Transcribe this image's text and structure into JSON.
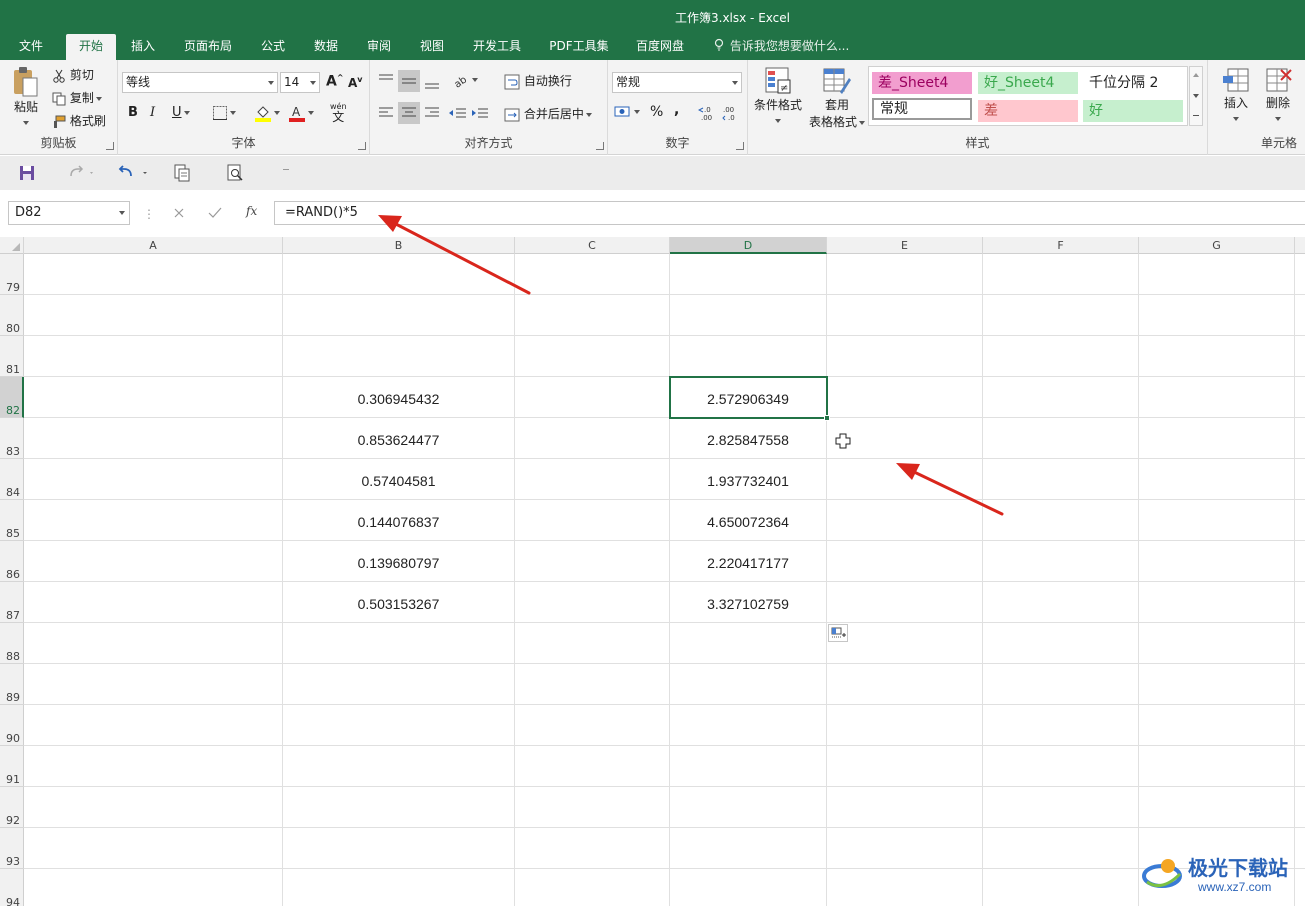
{
  "window": {
    "title": "工作簿3.xlsx - Excel"
  },
  "tabs": [
    {
      "label": "文件",
      "active": false
    },
    {
      "label": "开始",
      "active": true
    },
    {
      "label": "插入",
      "active": false
    },
    {
      "label": "页面布局",
      "active": false
    },
    {
      "label": "公式",
      "active": false
    },
    {
      "label": "数据",
      "active": false
    },
    {
      "label": "审阅",
      "active": false
    },
    {
      "label": "视图",
      "active": false
    },
    {
      "label": "开发工具",
      "active": false
    },
    {
      "label": "PDF工具集",
      "active": false
    },
    {
      "label": "百度网盘",
      "active": false
    }
  ],
  "tell_me": "告诉我您想要做什么...",
  "ribbon": {
    "clipboard": {
      "label": "剪贴板",
      "paste": "粘贴",
      "cut": "剪切",
      "copy": "复制",
      "format_painter": "格式刷"
    },
    "font": {
      "label": "字体",
      "name": "等线",
      "size": "14",
      "bold": "B",
      "italic": "I",
      "underline": "U",
      "wen": "wén",
      "wen_char": "文"
    },
    "alignment": {
      "label": "对齐方式",
      "wrap": "自动换行",
      "merge": "合并后居中"
    },
    "number": {
      "label": "数字",
      "format": "常规",
      "percent": "%",
      "comma": ",",
      "inc_decimal": "←.0 .00",
      "dec_decimal": ".00 →.0"
    },
    "styles": {
      "label": "样式",
      "conditional": "条件格式",
      "table_format_1": "套用",
      "table_format_2": "表格格式",
      "cells": [
        {
          "label": "差_Sheet4",
          "bg": "#f29ecf",
          "fg": "#9c0060"
        },
        {
          "label": "好_Sheet4",
          "bg": "#c6efce",
          "fg": "#3aa84d"
        },
        {
          "label": "千位分隔 2",
          "bg": "#ffffff",
          "fg": "#222222"
        },
        {
          "label": "常规",
          "bg": "#ffffff",
          "fg": "#222222"
        },
        {
          "label": "差",
          "bg": "#ffc7ce",
          "fg": "#c0504d"
        },
        {
          "label": "好",
          "bg": "#c6efce",
          "fg": "#3aa84d"
        }
      ]
    },
    "cells_group": {
      "label": "单元格",
      "insert": "插入",
      "delete": "删除"
    }
  },
  "formula_bar": {
    "name_box": "D82",
    "fx": "fx",
    "formula": "=RAND()*5"
  },
  "columns": [
    "A",
    "B",
    "C",
    "D",
    "E",
    "F",
    "G"
  ],
  "selected_column": "D",
  "rows": [
    "79",
    "80",
    "81",
    "82",
    "83",
    "84",
    "85",
    "86",
    "87",
    "88",
    "89",
    "90",
    "91",
    "92",
    "93",
    "94"
  ],
  "selected_row": "82",
  "column_b": [
    "0.306945432",
    "0.853624477",
    "0.57404581",
    "0.144076837",
    "0.139680797",
    "0.503153267"
  ],
  "column_d": [
    "2.572906349",
    "2.825847558",
    "1.937732401",
    "4.650072364",
    "2.220417177",
    "3.327102759"
  ],
  "watermark": {
    "text": "极光下载站",
    "url": "www.xz7.com"
  },
  "colors": {
    "accent": "#217346",
    "arrow": "#d9261c"
  }
}
